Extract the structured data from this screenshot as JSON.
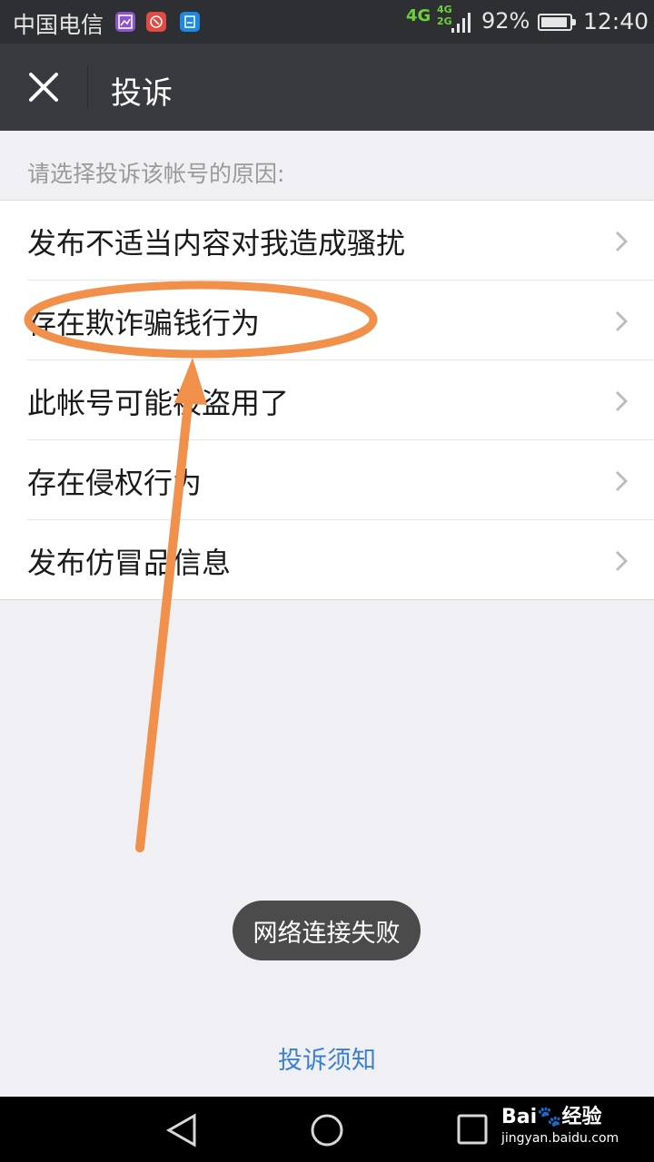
{
  "status_bar": {
    "carrier": "中国电信",
    "network": "4G",
    "network_secondary": "4G\n2G",
    "battery_percent": "92%",
    "battery_level": 0.92,
    "time": "12:40"
  },
  "header": {
    "title": "投诉",
    "close_icon": "close-icon"
  },
  "prompt": "请选择投诉该帐号的原因:",
  "reasons": [
    {
      "label": "发布不适当内容对我造成骚扰"
    },
    {
      "label": "存在欺诈骗钱行为"
    },
    {
      "label": "此帐号可能被盗用了"
    },
    {
      "label": "存在侵权行为"
    },
    {
      "label": "发布仿冒品信息"
    }
  ],
  "toast": "网络连接失败",
  "footer_link": "投诉须知",
  "watermark": {
    "brand": "Bai🐾经验",
    "url": "jingyan.baidu.com"
  },
  "colors": {
    "titlebar": "#393a3f",
    "link": "#3a7fd0",
    "annotation": "#f0904a",
    "network_green": "#6fcf3a"
  }
}
